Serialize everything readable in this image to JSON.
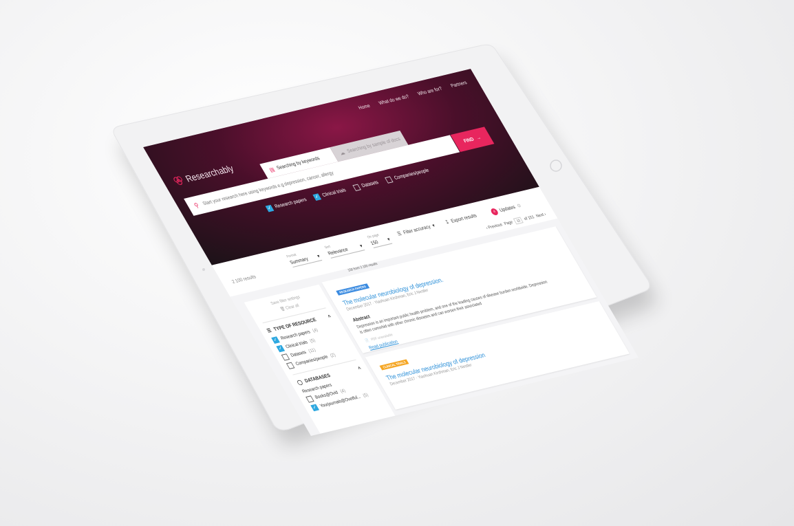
{
  "nav": {
    "items": [
      "Home",
      "What do we do?",
      "Who are for?",
      "Partners"
    ]
  },
  "brand": {
    "name": "Researchably",
    "accent": "#e8265e",
    "hero_dark": "#1c1218",
    "hero_magenta": "#8a1746"
  },
  "search": {
    "tab_keywords": "Searching by keywords",
    "tab_sample": "Searching by sample of docs",
    "placeholder": "Start your research here using keywords e.g depression, cancer, allergy",
    "find_label": "FIND"
  },
  "resource_filters": [
    {
      "label": "Research papers",
      "checked": true
    },
    {
      "label": "Clinical trials",
      "checked": true
    },
    {
      "label": "Datasets",
      "checked": false
    },
    {
      "label": "Companies/people",
      "checked": false
    }
  ],
  "toolbar": {
    "results_count": "2 100 results",
    "format_label": "Format",
    "format_value": "Summary",
    "sort_label": "Sort",
    "sort_value": "Relevance",
    "perpage_label": "On page",
    "perpage_value": "150",
    "filter_accuracy": "Filter accuracy",
    "export": "Export results",
    "updates": "Updates",
    "updates_count": "4",
    "prev": "Previous",
    "page_label": "Page",
    "page_value": "12",
    "page_of": "of 151",
    "next": "Next"
  },
  "sidebar": {
    "save_filter": "Save filter settings",
    "clear_all": "Clear all",
    "type_heading": "TYPE OF RESOURCE",
    "types": [
      {
        "label": "Research papers",
        "count": "(4)",
        "checked": true
      },
      {
        "label": "Clinical trials",
        "count": "(5)",
        "checked": true
      },
      {
        "label": "Datasets",
        "count": "(11)",
        "checked": false
      },
      {
        "label": "Companies/people",
        "count": "(2)",
        "checked": false
      }
    ],
    "db_heading": "DATABASES",
    "db_sub": "Research papers",
    "dbs": [
      {
        "label": "Books@Ovid",
        "count": "(4)",
        "checked": false
      },
      {
        "label": "Yourjournals@Ovetful...",
        "count": "(5)",
        "checked": true
      }
    ]
  },
  "results": {
    "info": "150 from 2 100 results",
    "items": [
      {
        "badge": "RESEARCH PAPERS",
        "title": "The molecular neurobiology of depression.",
        "meta": "December 2017 · Yiaohuan Kirshman, Eric J Nestler",
        "abstract_heading": "Abstract",
        "abstract": "Depression is an important public health problem, and one of the leading causes of disease burden worldwide. Depression is often comorbid with other chronic diseases and can worsen their associated",
        "pdf_note": "PDF unavailable",
        "read_link": "Read publication"
      },
      {
        "badge": "CLINICAL TRIALS",
        "title": "The molecular neurobiology of depression",
        "meta": "December 2017 · Yiaohuan Kirshman, Eric J Nestler"
      }
    ]
  }
}
